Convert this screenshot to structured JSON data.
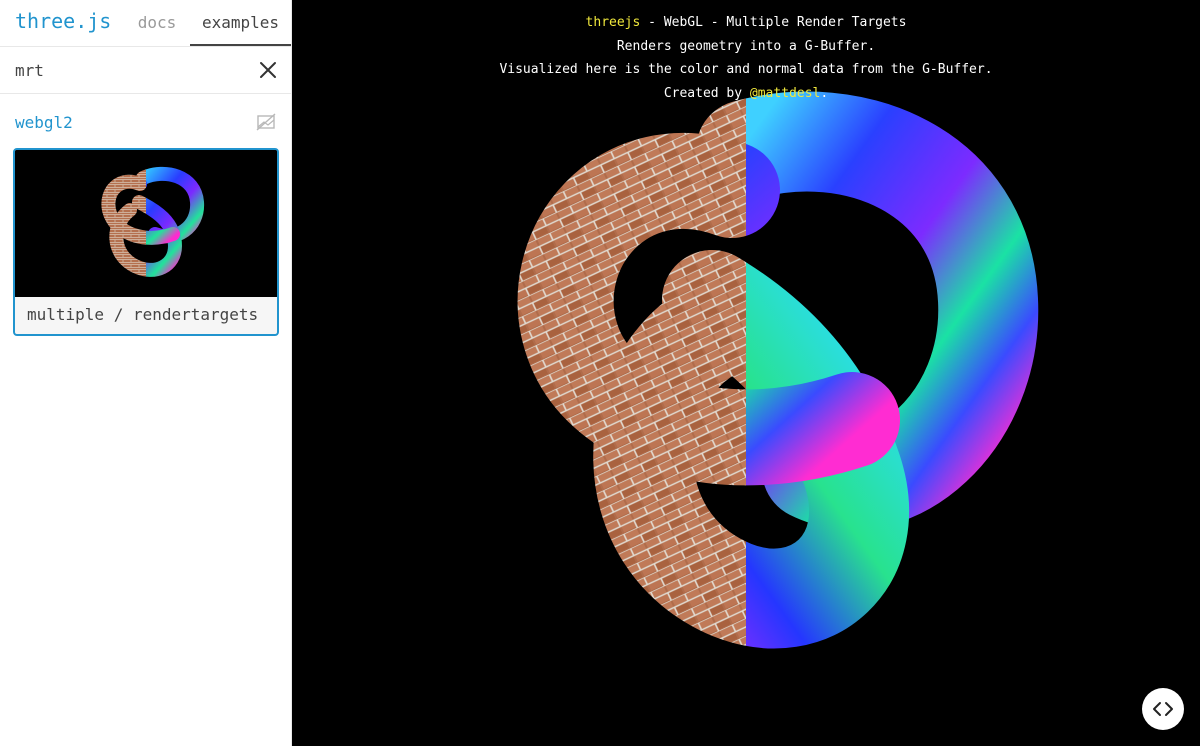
{
  "app": {
    "logo": "three.js",
    "tabs": [
      {
        "label": "docs",
        "active": false
      },
      {
        "label": "examples",
        "active": true
      }
    ]
  },
  "filter": {
    "value": "mrt",
    "clear_icon": "close-icon"
  },
  "sidebar": {
    "category": "webgl2",
    "screenshots_toggle_icon": "image-off-icon",
    "example": {
      "label": "multiple / rendertargets",
      "selected": true
    }
  },
  "viewport": {
    "info": {
      "line1_link": "threejs",
      "line1_text": " - WebGL - Multiple Render Targets",
      "line2": "Renders geometry into a G-Buffer.",
      "line3": "Visualized here is the color and normal data from the G-Buffer.",
      "line4_prefix": "Created by ",
      "line4_link": "@mattdesl",
      "line4_suffix": "."
    },
    "code_button_icon": "code-icon"
  },
  "colors": {
    "accent": "#2194ce",
    "info_link": "#f0e83c",
    "brick": "#b4704f",
    "mortar": "#d9d2c8",
    "background": "#000000"
  }
}
